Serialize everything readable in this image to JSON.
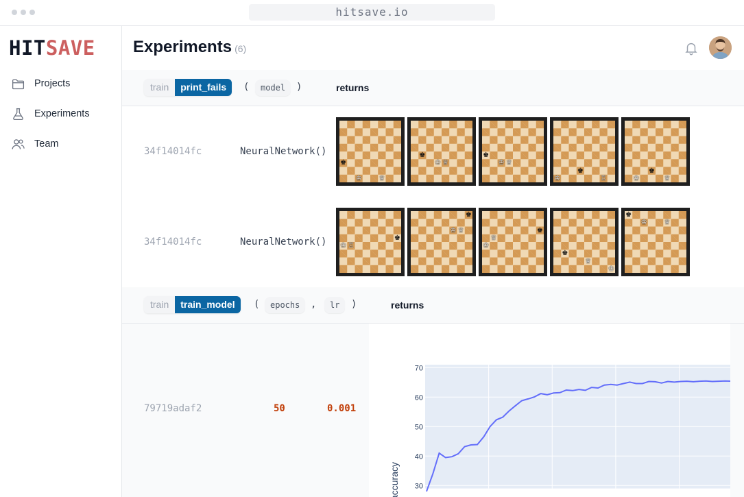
{
  "browser": {
    "url": "hitsave.io"
  },
  "logo": {
    "hit": "HIT",
    "save": "SAVE"
  },
  "sidebar": {
    "items": [
      {
        "label": "Projects",
        "icon": "folder-icon"
      },
      {
        "label": "Experiments",
        "icon": "flask-icon"
      },
      {
        "label": "Team",
        "icon": "users-icon"
      }
    ]
  },
  "header": {
    "title": "Experiments",
    "count": "(6)"
  },
  "sections": [
    {
      "module": "train",
      "function": "print_fails",
      "open_paren": "(",
      "args": [
        "model"
      ],
      "close_paren": ")",
      "returns": "returns",
      "rows": [
        {
          "hash": "34f14014fc",
          "model": "NeuralNetwork()"
        },
        {
          "hash": "34f14014fc",
          "model": "NeuralNetwork()"
        }
      ]
    },
    {
      "module": "train",
      "function": "train_model",
      "open_paren": "(",
      "args": [
        "epochs",
        "lr"
      ],
      "comma": ",",
      "close_paren": ")",
      "returns": "returns",
      "rows": [
        {
          "hash": "79719adaf2",
          "epochs": "50",
          "lr": "0.001"
        }
      ]
    }
  ],
  "boards": [
    [
      [
        {
          "p": "♚",
          "c": "b",
          "f": 0,
          "r": 2
        },
        {
          "p": "♔",
          "c": "w",
          "f": 2,
          "r": 0
        },
        {
          "p": "♕",
          "c": "w",
          "f": 5,
          "r": 0
        }
      ],
      [
        {
          "p": "♚",
          "c": "b",
          "f": 1,
          "r": 3
        },
        {
          "p": "♔",
          "c": "w",
          "f": 3,
          "r": 2
        },
        {
          "p": "♕",
          "c": "w",
          "f": 4,
          "r": 2
        }
      ],
      [
        {
          "p": "♚",
          "c": "b",
          "f": 0,
          "r": 3
        },
        {
          "p": "♔",
          "c": "w",
          "f": 2,
          "r": 2
        },
        {
          "p": "♕",
          "c": "w",
          "f": 3,
          "r": 2
        }
      ],
      [
        {
          "p": "♔",
          "c": "w",
          "f": 0,
          "r": 0
        },
        {
          "p": "♚",
          "c": "b",
          "f": 3,
          "r": 1
        },
        {
          "p": "♖",
          "c": "w",
          "f": 6,
          "r": 0
        }
      ],
      [
        {
          "p": "♔",
          "c": "w",
          "f": 1,
          "r": 0
        },
        {
          "p": "♚",
          "c": "b",
          "f": 3,
          "r": 1
        },
        {
          "p": "♕",
          "c": "w",
          "f": 5,
          "r": 0
        }
      ]
    ],
    [
      [
        {
          "p": "♔",
          "c": "w",
          "f": 0,
          "r": 3
        },
        {
          "p": "♖",
          "c": "w",
          "f": 1,
          "r": 3
        },
        {
          "p": "♚",
          "c": "b",
          "f": 7,
          "r": 4
        }
      ],
      [
        {
          "p": "♔",
          "c": "w",
          "f": 5,
          "r": 5
        },
        {
          "p": "♕",
          "c": "w",
          "f": 6,
          "r": 5
        },
        {
          "p": "♚",
          "c": "b",
          "f": 7,
          "r": 7
        }
      ],
      [
        {
          "p": "♔",
          "c": "w",
          "f": 0,
          "r": 3
        },
        {
          "p": "♕",
          "c": "w",
          "f": 1,
          "r": 4
        },
        {
          "p": "♚",
          "c": "b",
          "f": 7,
          "r": 5
        }
      ],
      [
        {
          "p": "♚",
          "c": "b",
          "f": 1,
          "r": 2
        },
        {
          "p": "♕",
          "c": "w",
          "f": 4,
          "r": 1
        },
        {
          "p": "♔",
          "c": "w",
          "f": 7,
          "r": 0
        }
      ],
      [
        {
          "p": "♚",
          "c": "b",
          "f": 0,
          "r": 7
        },
        {
          "p": "♔",
          "c": "w",
          "f": 2,
          "r": 6
        },
        {
          "p": "♕",
          "c": "w",
          "f": 5,
          "r": 6
        }
      ]
    ]
  ],
  "chart_data": {
    "type": "line",
    "ylabel": "accuracy",
    "yticks": [
      30,
      40,
      50,
      60,
      70
    ],
    "ylim": [
      29,
      71
    ],
    "grid": true,
    "color": "#636efa",
    "x": [
      0,
      1,
      2,
      3,
      4,
      5,
      6,
      7,
      8,
      9,
      10,
      11,
      12,
      13,
      14,
      15,
      16,
      17,
      18,
      19,
      20,
      21,
      22,
      23,
      24,
      25,
      26,
      27,
      28,
      29,
      30,
      31,
      32,
      33,
      34,
      35,
      36,
      37,
      38,
      39,
      40,
      41,
      42,
      43,
      44,
      45,
      46,
      47,
      48,
      49
    ],
    "values": [
      28,
      34,
      41,
      39.5,
      39.8,
      40.8,
      43.2,
      43.8,
      43.9,
      46.5,
      50,
      52.3,
      53.2,
      55.3,
      57.1,
      58.8,
      59.4,
      60.1,
      61.2,
      60.8,
      61.4,
      61.5,
      62.4,
      62.2,
      62.6,
      62.3,
      63.3,
      63.1,
      64.1,
      64.3,
      64.1,
      64.6,
      65.1,
      64.6,
      64.6,
      65.3,
      65.2,
      64.8,
      65.3,
      65.1,
      65.3,
      65.4,
      65.2,
      65.4,
      65.5,
      65.3,
      65.4,
      65.5,
      65.4,
      65.5
    ]
  }
}
